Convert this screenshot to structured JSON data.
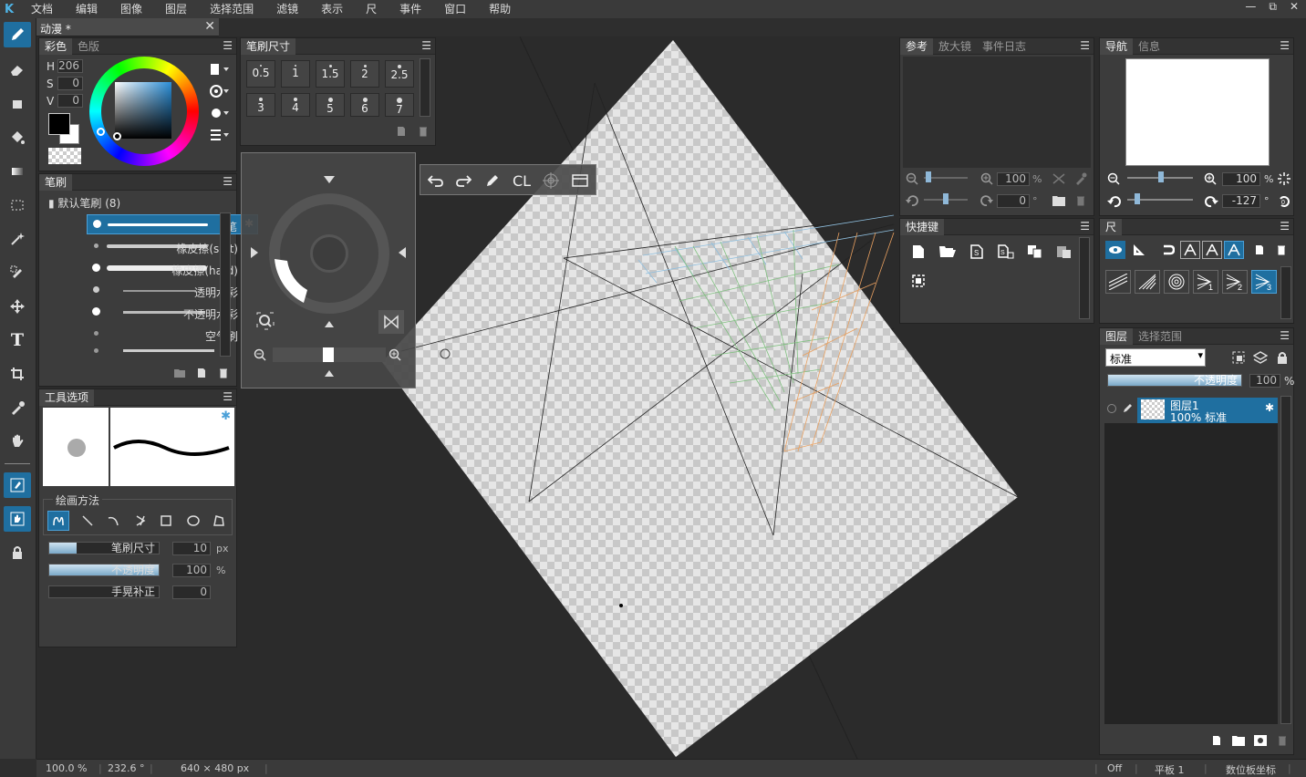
{
  "app": {
    "logo": "K"
  },
  "menu": {
    "items": [
      "文档",
      "编辑",
      "图像",
      "图层",
      "选择范围",
      "滤镜",
      "表示",
      "尺",
      "事件",
      "窗口",
      "帮助"
    ]
  },
  "window_controls": {
    "minimize": "—",
    "restore": "⧉",
    "close": "✕"
  },
  "document_tab": {
    "title": "动漫 *",
    "close": "✕"
  },
  "color_panel": {
    "tabs": [
      "彩色",
      "色版"
    ],
    "h_label": "H",
    "h_value": "206",
    "s_label": "S",
    "s_value": "0",
    "v_label": "V",
    "v_value": "0",
    "fg": "#000000",
    "bg": "#ffffff"
  },
  "brush_size_panel": {
    "title": "笔刷尺寸",
    "sizes": [
      "0.5",
      "1",
      "1.5",
      "2",
      "2.5",
      "3",
      "4",
      "5",
      "6",
      "7"
    ]
  },
  "brush_panel": {
    "title": "笔刷",
    "group": "默认笔刷 (8)",
    "items": [
      "笔",
      "橡皮擦(soft)",
      "橡皮擦(hard)",
      "透明水彩",
      "不透明水彩",
      "空气刷"
    ]
  },
  "tool_options": {
    "title": "工具选项",
    "draw_method": "绘画方法",
    "brush_size_label": "笔刷尺寸",
    "brush_size_value": "10",
    "brush_size_unit": "px",
    "opacity_label": "不透明度",
    "opacity_value": "100",
    "opacity_unit": "%",
    "stabilizer_label": "手晃补正",
    "stabilizer_value": "0",
    "brush_size_fill": 0.25,
    "opacity_fill": 1.0
  },
  "quick_toolbar": {
    "cl": "CL"
  },
  "reference_panel": {
    "tabs": [
      "参考",
      "放大镜",
      "事件日志"
    ],
    "zoom": "100",
    "zoom_unit": "%",
    "rotate": "0",
    "rotate_unit": "°"
  },
  "shortcut_panel": {
    "title": "快捷键"
  },
  "navigator_panel": {
    "tabs": [
      "导航",
      "信息"
    ],
    "zoom": "100",
    "zoom_unit": "%",
    "rotate": "-127",
    "rotate_unit": "°"
  },
  "ruler_panel": {
    "title": "尺",
    "vp1": "1",
    "vp2": "2",
    "vp3": "3"
  },
  "layer_panel": {
    "tabs": [
      "图层",
      "选择范围"
    ],
    "blend_mode": "标准",
    "opacity_label": "不透明度",
    "opacity_value": "100",
    "opacity_unit": "%",
    "layers": [
      {
        "name": "图层1",
        "info": "100% 标准"
      }
    ]
  },
  "status": {
    "zoom": "100.0 %",
    "angle": "232.6 °",
    "size": "640 × 480 px",
    "off": "Off",
    "tablet": "平板 1",
    "coord": "数位板坐标"
  }
}
